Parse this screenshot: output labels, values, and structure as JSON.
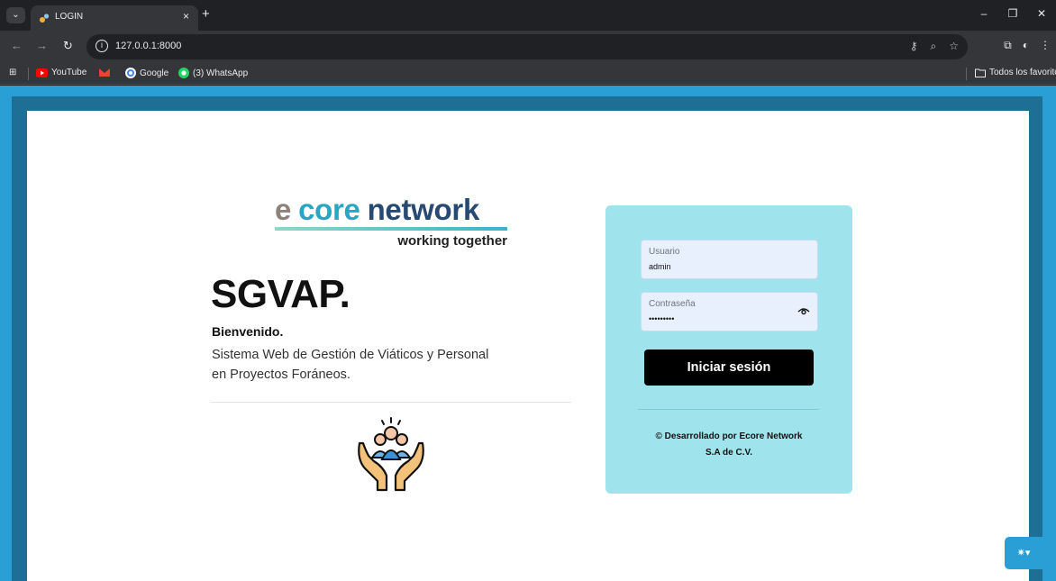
{
  "browser": {
    "tab_title": "LOGIN",
    "tab_close": "×",
    "new_tab": "+",
    "url": "127.0.0.1:8000",
    "bookmarks": [
      {
        "label": "YouTube"
      },
      {
        "label": "Google"
      },
      {
        "label": "(3) WhatsApp"
      }
    ],
    "all_bookmarks": "Todos los favoritos"
  },
  "logo": {
    "word1": "e",
    "word2": "core",
    "word3": "network",
    "tagline": "working together"
  },
  "hero": {
    "title": "SGVAP.",
    "welcome": "Bienvenido.",
    "description_line1": "Sistema Web de Gestión de Viáticos y Personal",
    "description_line2": "en Proyectos Foráneos."
  },
  "login": {
    "username_label": "Usuario",
    "username_value": "admin",
    "password_label": "Contraseña",
    "password_value": "•••••••••",
    "submit_label": "Iniciar sesión",
    "credits_line1": "© Desarrollado por Ecore Network",
    "credits_line2": "S.A de C.V."
  },
  "colors": {
    "page_background": "#2a9fd6",
    "card_background": "#9fe4ec",
    "logo_core": "#2aa6c4",
    "logo_network": "#274a73",
    "button": "#000000"
  }
}
